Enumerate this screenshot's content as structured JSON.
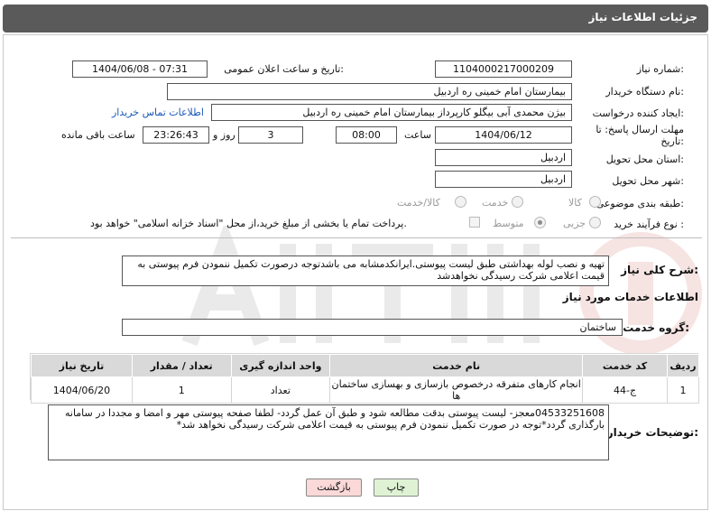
{
  "header": {
    "title": "جزئیات اطلاعات نیاز"
  },
  "fields": {
    "need_number_label": "شماره نیاز:",
    "need_number": "1104000217000209",
    "announce_label": "تاریخ و ساعت اعلان عمومی:",
    "announce_value": "1404/06/08 - 07:31",
    "buyer_label": "نام دستگاه خریدار:",
    "buyer_value": "بیمارستان امام خمینی  ره  اردبیل",
    "creator_label": "ایجاد کننده درخواست:",
    "creator_value": "بیژن محمدی آبی بیگلو کارپرداز بیمارستان امام خمینی  ره  اردبیل",
    "contact_link": "اطلاعات تماس خریدار",
    "deadline_label_1": "مهلت ارسال پاسخ: تا",
    "deadline_label_2": "تاریخ:",
    "deadline_date": "1404/06/12",
    "time_label": "ساعت",
    "deadline_time": "08:00",
    "days_value": "3",
    "days_label": "روز و",
    "remaining_value": "23:26:43",
    "remaining_label": "ساعت باقی مانده",
    "province_label": "استان محل تحویل:",
    "province_value": "اردبیل",
    "city_label": "شهر محل تحویل:",
    "city_value": "اردبیل",
    "category_label": "طبقه بندی موضوعی:",
    "category_options": [
      "کالا",
      "خدمت",
      "کالا/خدمت"
    ],
    "process_label": "نوع فرآیند خرید :",
    "process_options": [
      "جزیی",
      "متوسط"
    ],
    "payment_note": "پرداخت تمام یا بخشی از مبلغ خرید،از محل \"اسناد خزانه اسلامی\" خواهد بود."
  },
  "description": {
    "label": "شرح کلی نیاز:",
    "text": "تهیه و نصب لوله بهداشتی طبق لیست پیوستی.ایرانکدمشابه می باشدتوجه درصورت تکمیل ننمودن فرم پیوستی به قیمت اعلامی شرکت رسیدگی نخواهدشد"
  },
  "services": {
    "section_title": "اطلاعات خدمات مورد نیاز",
    "group_label": "گروه خدمت:",
    "group_value": "ساختمان",
    "columns": [
      "ردیف",
      "کد خدمت",
      "نام خدمت",
      "واحد اندازه گیری",
      "تعداد / مقدار",
      "تاریخ نیاز"
    ],
    "rows": [
      [
        "1",
        "ج-44",
        "انجام کارهای متفرقه درخصوص بازسازی و بهسازی ساختمان ها",
        "تعداد",
        "1",
        "1404/06/20"
      ]
    ]
  },
  "buyer_notes": {
    "label": "توضیحات خریدار:",
    "text": "04533251608معجز- لیست پیوستی بدقت مطالعه شود و طبق آن عمل گردد- لطفا صفحه پیوستی مهر و امضا و مجددا در سامانه بارگذاری گردد*توجه در صورت تکمیل ننمودن فرم پیوستی به قیمت اعلامی شرکت رسیدگی نخواهد شد*"
  },
  "buttons": {
    "print": "چاپ",
    "back": "بازگشت"
  },
  "colors": {
    "header_bg": "#5a5a5a",
    "print_bg": "#dff3d4",
    "back_bg": "#fbd9d9",
    "link": "#1a58b5"
  }
}
